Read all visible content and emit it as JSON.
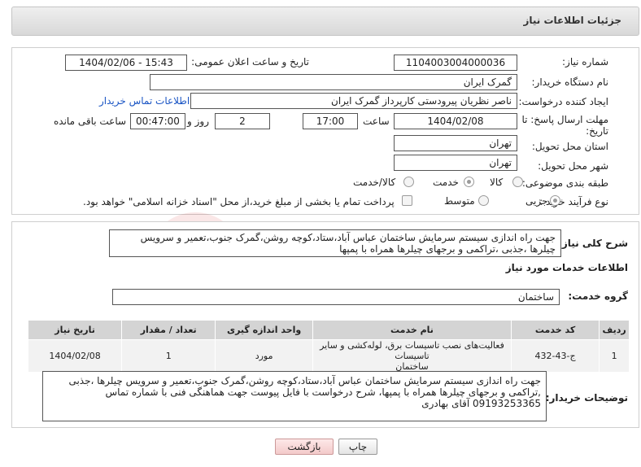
{
  "header": {
    "title": "جزئیات اطلاعات نیاز"
  },
  "need_number": {
    "label": "شماره نیاز:",
    "value": "1104003004000036"
  },
  "announce_date": {
    "label": "تاریخ و ساعت اعلان عمومی:",
    "value": "1404/02/06 - 15:43"
  },
  "buyer_org": {
    "label": "نام دستگاه خریدار:",
    "value": "گمرک ایران"
  },
  "requester": {
    "label": "ایجاد کننده درخواست:",
    "value": "ناصر نظریان پیرودستی کارپرداز گمرک ایران",
    "contact_link": "اطلاعات تماس خریدار"
  },
  "deadline": {
    "label_line1": "مهلت ارسال پاسخ: تا",
    "label_line2": "تاریخ:",
    "date": "1404/02/08",
    "time_label": "ساعت",
    "time": "17:00",
    "days": "2",
    "days_label": "روز و",
    "remaining": "00:47:00",
    "remaining_label": "ساعت باقی مانده"
  },
  "delivery_province": {
    "label": "استان محل تحویل:",
    "value": "تهران"
  },
  "delivery_city": {
    "label": "شهر محل تحویل:",
    "value": "تهران"
  },
  "category": {
    "label": "طبقه بندی موضوعی:",
    "options": [
      "کالا",
      "خدمت",
      "کالا/خدمت"
    ],
    "selected": "خدمت"
  },
  "purchase_type": {
    "label": "نوع فرآیند خرید :",
    "options": [
      "جزیی",
      "متوسط"
    ],
    "selected": "جزیی",
    "treasury_note": "پرداخت تمام یا بخشی از مبلغ خرید،از محل \"اسناد خزانه اسلامی\" خواهد بود."
  },
  "general_desc": {
    "label": "شرح کلی نیاز:",
    "line1": "جهت راه اندازی سیستم سرمایش ساختمان عباس آباد،ستاد،کوچه روشن،گمرک جنوب،تعمیر و سرویس",
    "line2": "چیلرها ،جذبی ،تراکمی و برجهای چیلرها همراه با پمپها"
  },
  "services_section": {
    "title": "اطلاعات خدمات مورد نیاز"
  },
  "service_group": {
    "label": "گروه خدمت:",
    "value": "ساختمان"
  },
  "table": {
    "headers": [
      "ردیف",
      "کد خدمت",
      "نام خدمت",
      "واحد اندازه گیری",
      "تعداد / مقدار",
      "تاریخ نیاز"
    ],
    "rows": [
      {
        "row": "1",
        "code": "ج-43-432",
        "name_line1": "فعالیت‌های نصب تاسیسات برق، لوله‌کشی و سایر تاسیسات",
        "name_line2": "ساختمان",
        "unit": "مورد",
        "qty": "1",
        "date": "1404/02/08"
      }
    ]
  },
  "buyer_desc": {
    "label": "توضیحات خریدار:",
    "line1": "جهت راه اندازی سیستم سرمایش ساختمان عباس آباد،ستاد،کوچه روشن،گمرک جنوب،تعمیر و سرویس چیلرها ،جذبی",
    "line2": ",تراکمی و برجهای چیلرها همراه با پمپها، شرح درخواست با فایل پیوست جهت هماهنگی فنی با شماره تماس",
    "line3": "09193253365 آقای بهادری"
  },
  "buttons": {
    "print": "چاپ",
    "back": "بازگشت"
  },
  "watermark": {
    "text": "AriaTender.neT"
  }
}
